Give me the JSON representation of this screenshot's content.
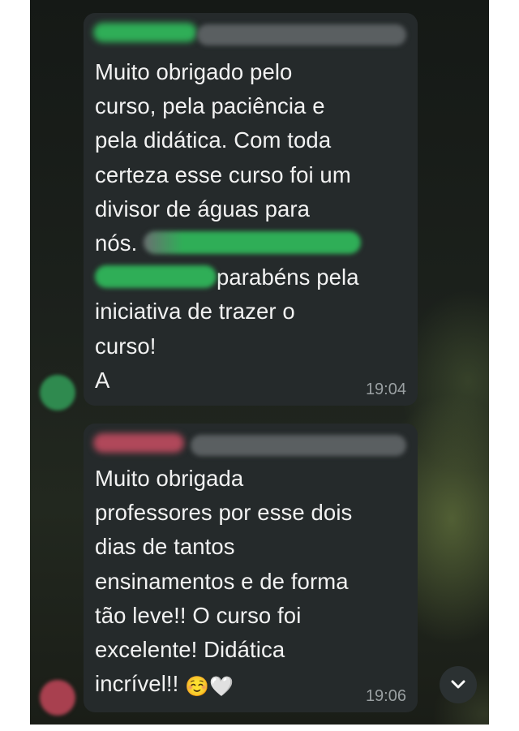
{
  "messages": [
    {
      "text_lines": [
        "Muito obrigado pelo",
        "curso, pela paciência e",
        "pela didática. Com toda",
        "certeza esse curso foi um",
        "divisor de águas para",
        "nós.",
        "parabéns pela",
        "iniciativa de trazer o",
        "curso!",
        "A"
      ],
      "time": "19:04"
    },
    {
      "text_lines": [
        "Muito obrigada",
        "professores por esse dois",
        "dias de tantos",
        "ensinamentos e de forma",
        "tão leve!! O curso foi",
        "excelente! Didática",
        "incrível!!"
      ],
      "emojis": [
        "☺️",
        "🤍"
      ],
      "time": "19:06"
    }
  ],
  "colors": {
    "bubble": "#252a2b",
    "text": "#f2f2f2",
    "time": "#9aa0a2",
    "sender1_blur": "#2fae57",
    "sender2_blur": "#b0485a"
  },
  "icons": {
    "scroll_down": "chevron-down-icon"
  }
}
